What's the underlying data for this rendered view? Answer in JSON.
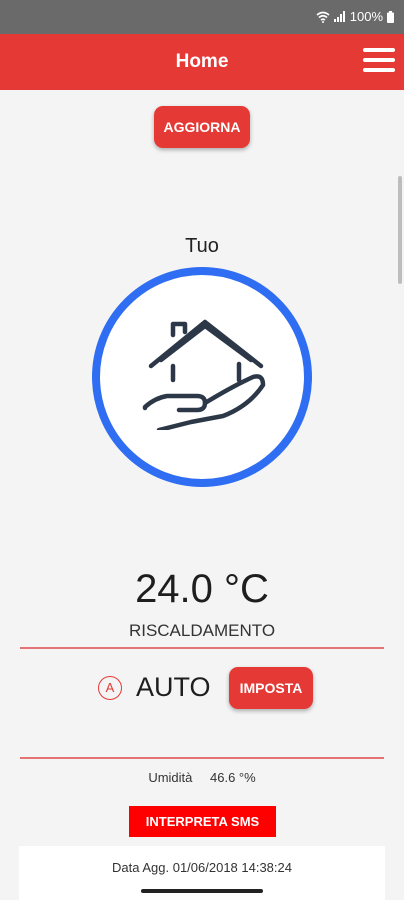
{
  "status_bar": {
    "battery": "100%"
  },
  "header": {
    "title": "Home"
  },
  "toolbar": {
    "refresh_label": "AGGIORNA"
  },
  "zone": {
    "name": "Tuo"
  },
  "thermostat": {
    "temperature": "24.0 °C",
    "mode": "RISCALDAMENTO",
    "auto_icon_letter": "A",
    "program": "AUTO",
    "set_label": "IMPOSTA"
  },
  "humidity": {
    "label": "Umidità",
    "value": "46.6 °%"
  },
  "sms": {
    "button_label": "INTERPRETA SMS"
  },
  "update": {
    "text": "Data Agg. 01/06/2018 14:38:24"
  },
  "colors": {
    "accent": "#e53935",
    "ring": "#2f6ef2",
    "sms_button": "#ff0000"
  }
}
